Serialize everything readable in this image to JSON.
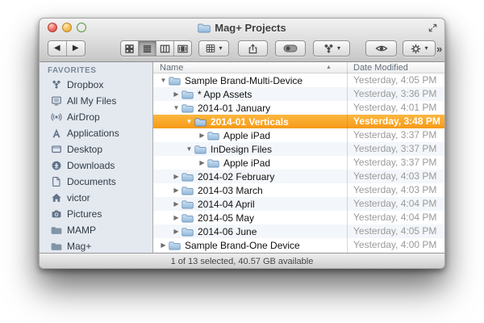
{
  "window": {
    "title": "Mag+ Projects",
    "title_icon": "folder-icon",
    "controls": [
      "close-button",
      "minimize-button",
      "zoom-button"
    ],
    "fullscreen_icon": "fullscreen-arrows-icon"
  },
  "toolbar": {
    "back_glyph": "◀",
    "forward_glyph": "▶",
    "dropdown_arrow": "▾",
    "overflow_label": "»",
    "buttons": [
      {
        "name": "back",
        "icon": "back-arrow-icon"
      },
      {
        "name": "forward",
        "icon": "forward-arrow-icon"
      },
      {
        "name": "icon-view",
        "icon": "grid-view-icon",
        "selected": false
      },
      {
        "name": "list-view",
        "icon": "list-view-icon",
        "selected": true
      },
      {
        "name": "column-view",
        "icon": "column-view-icon",
        "selected": false
      },
      {
        "name": "coverflow-view",
        "icon": "coverflow-view-icon",
        "selected": false
      },
      {
        "name": "arrange",
        "icon": "arrange-grid-icon",
        "has_dropdown": true
      },
      {
        "name": "share",
        "icon": "share-icon"
      },
      {
        "name": "toggle-pill",
        "icon": "pill-toggle-icon"
      },
      {
        "name": "dropbox",
        "icon": "dropbox-icon",
        "has_dropdown": true
      },
      {
        "name": "quick-look",
        "icon": "eye-icon"
      },
      {
        "name": "action",
        "icon": "gear-icon",
        "has_dropdown": true
      },
      {
        "name": "overflow",
        "label": "»"
      }
    ]
  },
  "sidebar": {
    "section_label": "FAVORITES",
    "items": [
      {
        "label": "Dropbox",
        "icon": "dropbox-icon"
      },
      {
        "label": "All My Files",
        "icon": "all-my-files-icon"
      },
      {
        "label": "AirDrop",
        "icon": "airdrop-icon"
      },
      {
        "label": "Applications",
        "icon": "applications-icon"
      },
      {
        "label": "Desktop",
        "icon": "desktop-icon"
      },
      {
        "label": "Downloads",
        "icon": "downloads-icon"
      },
      {
        "label": "Documents",
        "icon": "documents-icon"
      },
      {
        "label": "victor",
        "icon": "home-icon"
      },
      {
        "label": "Pictures",
        "icon": "pictures-icon"
      },
      {
        "label": "MAMP",
        "icon": "folder-icon"
      },
      {
        "label": "Mag+",
        "icon": "folder-icon"
      }
    ]
  },
  "list": {
    "columns": {
      "name": "Name",
      "date": "Date Modified"
    },
    "sort_indicator": "▲",
    "rows": [
      {
        "disclosure": "▼",
        "name": "Sample Brand-Multi-Device",
        "date": "Yesterday, 4:05 PM",
        "level": 0,
        "selected": false
      },
      {
        "disclosure": "▶",
        "name": "* App Assets",
        "date": "Yesterday, 3:36 PM",
        "level": 1,
        "selected": false
      },
      {
        "disclosure": "▼",
        "name": "2014-01 January",
        "date": "Yesterday, 4:01 PM",
        "level": 1,
        "selected": false
      },
      {
        "disclosure": "▼",
        "name": "2014-01 Verticals",
        "date": "Yesterday, 3:48 PM",
        "level": 2,
        "selected": true
      },
      {
        "disclosure": "▶",
        "name": "Apple iPad",
        "date": "Yesterday, 3:37 PM",
        "level": 3,
        "selected": false
      },
      {
        "disclosure": "▼",
        "name": "InDesign Files",
        "date": "Yesterday, 3:37 PM",
        "level": 2,
        "selected": false
      },
      {
        "disclosure": "▶",
        "name": "Apple iPad",
        "date": "Yesterday, 3:37 PM",
        "level": 3,
        "selected": false
      },
      {
        "disclosure": "▶",
        "name": "2014-02 February",
        "date": "Yesterday, 4:03 PM",
        "level": 1,
        "selected": false
      },
      {
        "disclosure": "▶",
        "name": "2014-03 March",
        "date": "Yesterday, 4:03 PM",
        "level": 1,
        "selected": false
      },
      {
        "disclosure": "▶",
        "name": "2014-04 April",
        "date": "Yesterday, 4:04 PM",
        "level": 1,
        "selected": false
      },
      {
        "disclosure": "▶",
        "name": "2014-05 May",
        "date": "Yesterday, 4:04 PM",
        "level": 1,
        "selected": false
      },
      {
        "disclosure": "▶",
        "name": "2014-06 June",
        "date": "Yesterday, 4:05 PM",
        "level": 1,
        "selected": false
      },
      {
        "disclosure": "▶",
        "name": "Sample Brand-One Device",
        "date": "Yesterday, 4:00 PM",
        "level": 0,
        "selected": false
      }
    ]
  },
  "status_bar": {
    "text": "1 of 13 selected, 40.57 GB available"
  },
  "colors": {
    "selection_top": "#FCB73F",
    "selection_bottom": "#F69A17",
    "row_stripe": "#F3F6FA",
    "sidebar_bg": "#E4E9F0",
    "folder_fill_top": "#CFE2F2",
    "folder_fill_bottom": "#92B9DC",
    "folder_stroke": "#6E94BA"
  }
}
